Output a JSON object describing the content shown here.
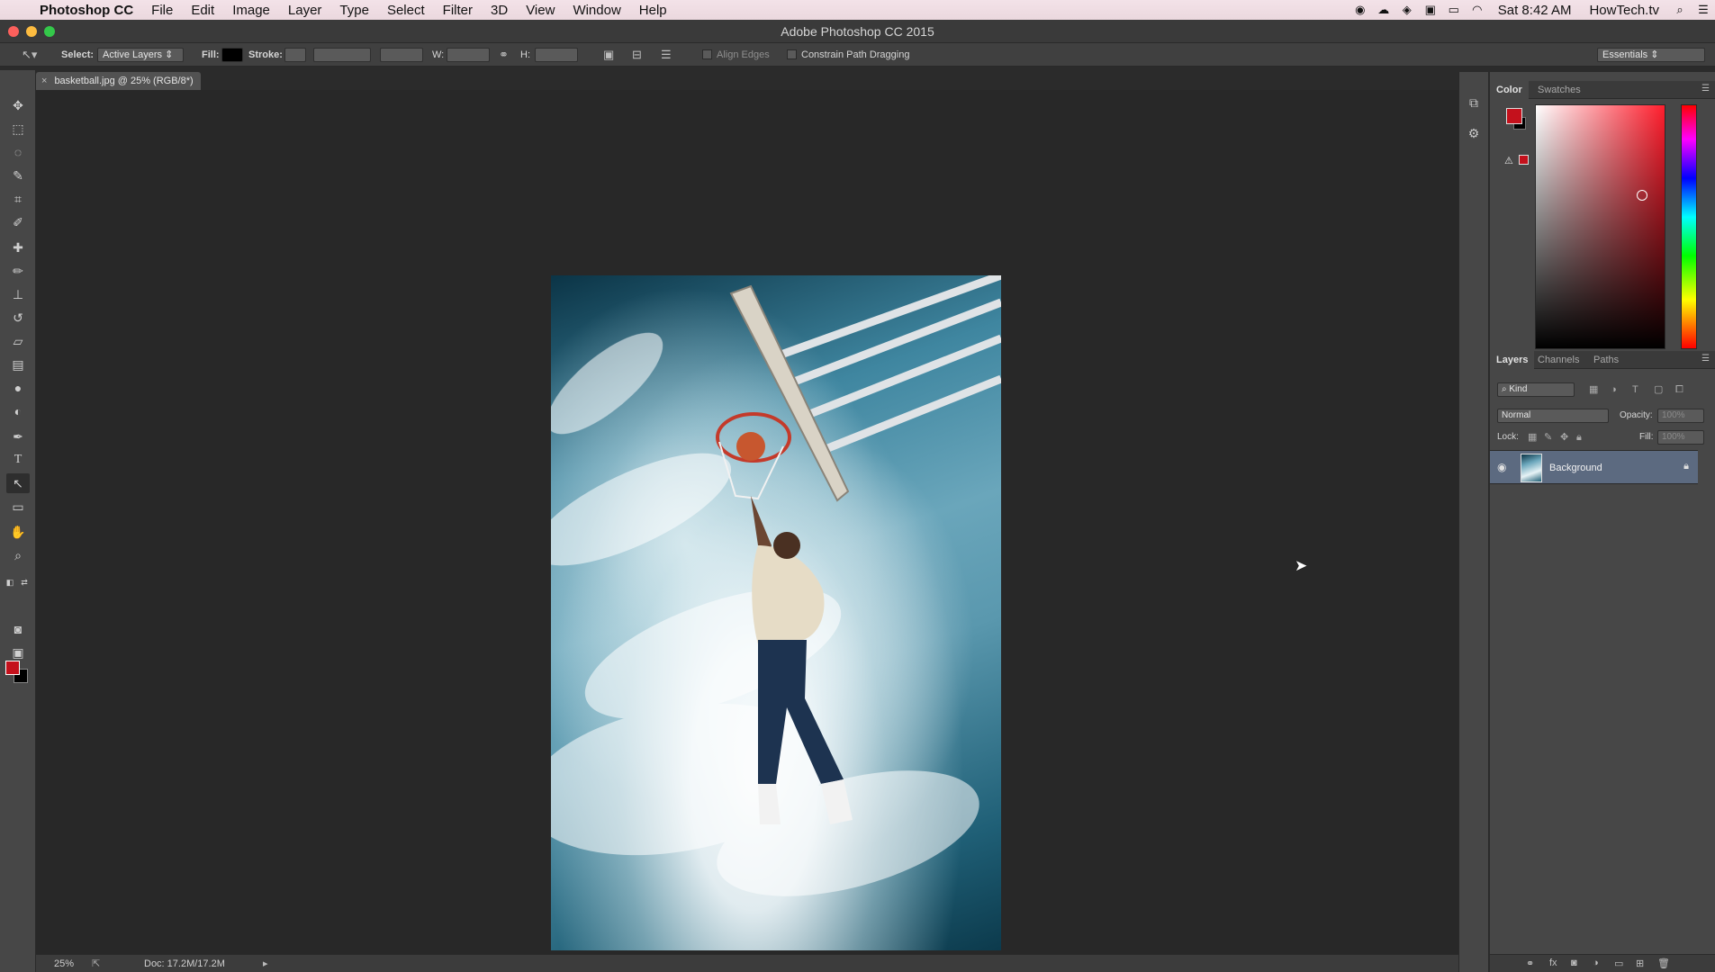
{
  "menubar": {
    "app_name": "Photoshop CC",
    "items": [
      "File",
      "Edit",
      "Image",
      "Layer",
      "Type",
      "Select",
      "Filter",
      "3D",
      "View",
      "Window",
      "Help"
    ],
    "clock": "Sat 8:42 AM",
    "user": "HowTech.tv"
  },
  "window": {
    "title": "Adobe Photoshop CC 2015"
  },
  "options_bar": {
    "select_label": "Select:",
    "select_value": "Active Layers",
    "fill_label": "Fill:",
    "stroke_label": "Stroke:",
    "w_label": "W:",
    "h_label": "H:",
    "align_edges": "Align Edges",
    "constrain_path": "Constrain Path Dragging",
    "workspace": "Essentials"
  },
  "document": {
    "tab_label": "basketball.jpg @ 25% (RGB/8*)"
  },
  "status": {
    "zoom": "25%",
    "doc_size": "Doc: 17.2M/17.2M"
  },
  "colors": {
    "foreground": "#c4111c",
    "background": "#000000"
  },
  "color_panel": {
    "tabs": [
      "Color",
      "Swatches"
    ]
  },
  "layers_panel": {
    "tabs": [
      "Layers",
      "Channels",
      "Paths"
    ],
    "filter_kind": "Kind",
    "blend_mode": "Normal",
    "opacity_label": "Opacity:",
    "opacity_value": "100%",
    "lock_label": "Lock:",
    "fill_label": "Fill:",
    "fill_value": "100%",
    "layers": [
      {
        "name": "Background",
        "visible": true,
        "locked": true
      }
    ]
  }
}
